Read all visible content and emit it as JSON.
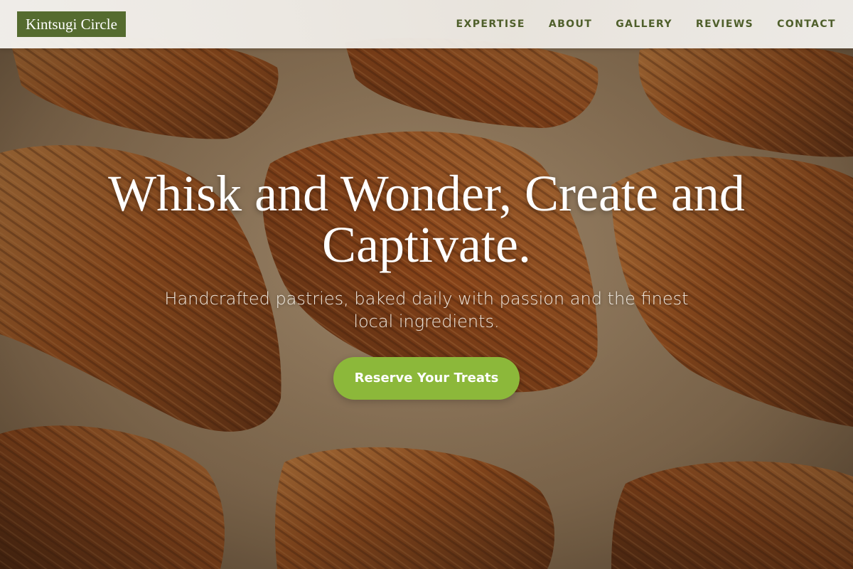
{
  "brand": {
    "logo_text": "Kintsugi Circle"
  },
  "nav": {
    "items": [
      {
        "label": "EXPERTISE"
      },
      {
        "label": "ABOUT"
      },
      {
        "label": "GALLERY"
      },
      {
        "label": "REVIEWS"
      },
      {
        "label": "CONTACT"
      }
    ]
  },
  "hero": {
    "title": "Whisk and Wonder, Create and Captivate.",
    "subtitle": "Handcrafted pastries, baked daily with passion and the finest local ingredients.",
    "cta_label": "Reserve Your Treats",
    "background_image": "croissants-on-parchment"
  },
  "colors": {
    "brand_green": "#556b2f",
    "nav_text": "#4f5f2b",
    "cta_green": "#8cb83a"
  }
}
